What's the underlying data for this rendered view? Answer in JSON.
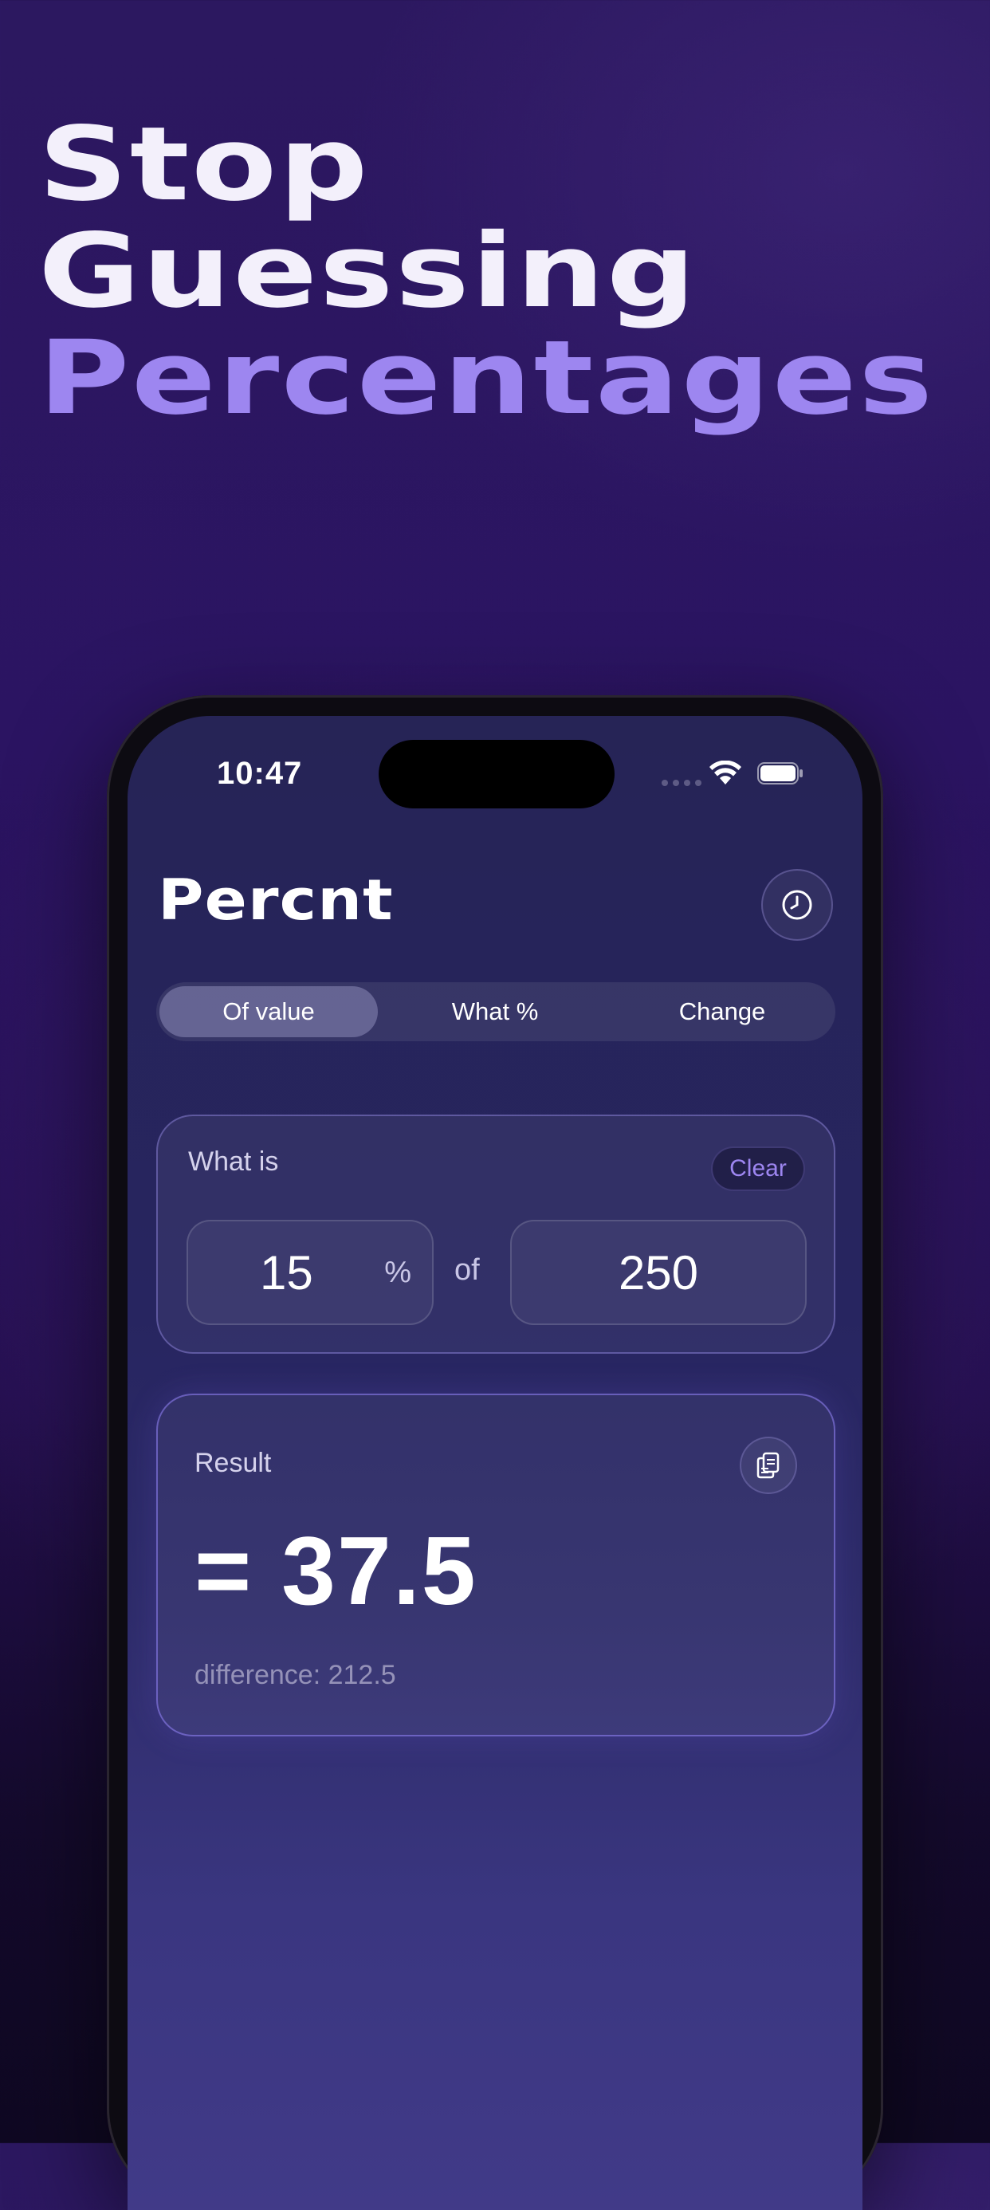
{
  "headline": {
    "line1": "Stop",
    "line2": "Guessing",
    "line3": "Percentages"
  },
  "status_bar": {
    "time": "10:47"
  },
  "app": {
    "title": "Percnt",
    "history_icon": "clock-icon"
  },
  "tabs": [
    {
      "label": "Of value",
      "active": true
    },
    {
      "label": "What %",
      "active": false
    },
    {
      "label": "Change",
      "active": false
    }
  ],
  "input_card": {
    "label": "What is",
    "clear_label": "Clear",
    "percent_value": "15",
    "percent_sign": "%",
    "of_label": "of",
    "base_value": "250"
  },
  "result_card": {
    "label": "Result",
    "value": "= 37.5",
    "difference": "difference: 212.5",
    "copy_icon": "copy-icon"
  },
  "colors": {
    "accent": "#9d86f0",
    "background_top": "#2c1860",
    "background_bottom": "#0f0822"
  }
}
